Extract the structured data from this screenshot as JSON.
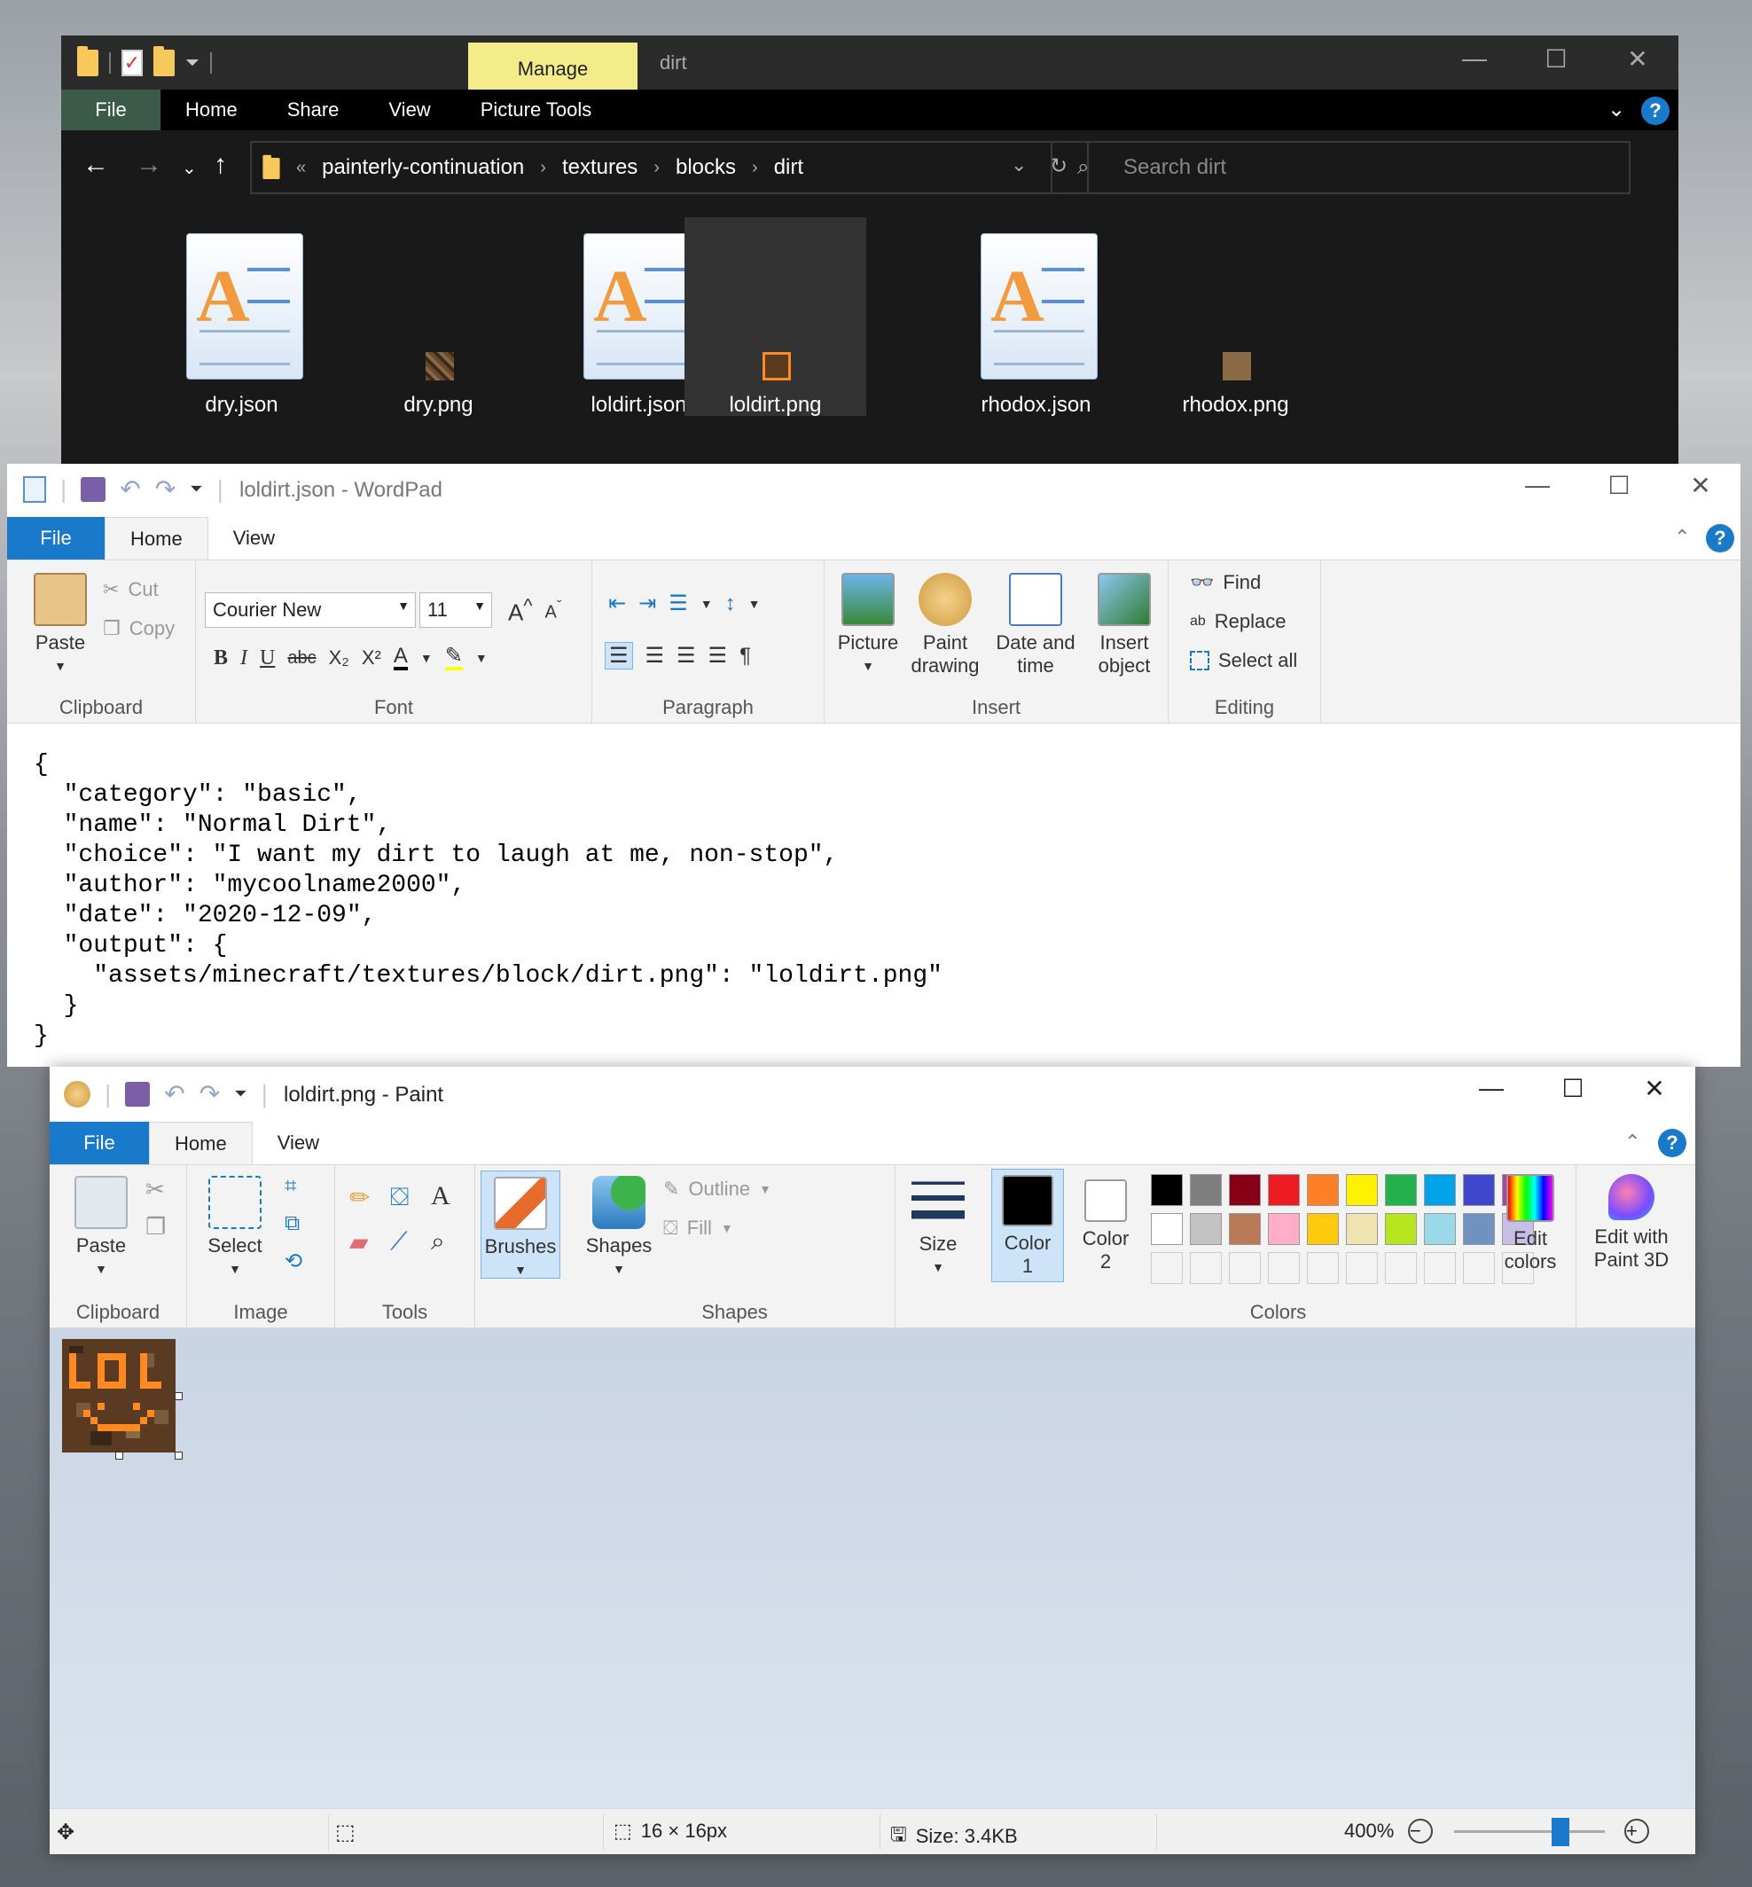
{
  "explorer": {
    "ribbon_manage": "Manage",
    "window_title": "dirt",
    "tabs": [
      "File",
      "Home",
      "Share",
      "View",
      "Picture Tools"
    ],
    "breadcrumbs": [
      "painterly-continuation",
      "textures",
      "blocks",
      "dirt"
    ],
    "search_placeholder": "Search dirt",
    "files": [
      {
        "name": "dry.json",
        "kind": "wordpad-doc"
      },
      {
        "name": "dry.png",
        "kind": "png"
      },
      {
        "name": "loldirt.json",
        "kind": "wordpad-doc"
      },
      {
        "name": "loldirt.png",
        "kind": "png",
        "selected": true
      },
      {
        "name": "rhodox.json",
        "kind": "wordpad-doc"
      },
      {
        "name": "rhodox.png",
        "kind": "png"
      }
    ]
  },
  "wordpad": {
    "title": "loldirt.json - WordPad",
    "tabs": {
      "file": "File",
      "home": "Home",
      "view": "View"
    },
    "clipboard": {
      "paste": "Paste",
      "cut": "Cut",
      "copy": "Copy",
      "group": "Clipboard"
    },
    "font": {
      "family": "Courier New",
      "size": "11",
      "group": "Font"
    },
    "paragraph": {
      "group": "Paragraph"
    },
    "insert": {
      "picture": "Picture",
      "paint_drawing_1": "Paint",
      "paint_drawing_2": "drawing",
      "date_time_1": "Date and",
      "date_time_2": "time",
      "insert_object_1": "Insert",
      "insert_object_2": "object",
      "group": "Insert"
    },
    "editing": {
      "find": "Find",
      "replace": "Replace",
      "select_all": "Select all",
      "group": "Editing"
    },
    "document_text": "{\n  \"category\": \"basic\",\n  \"name\": \"Normal Dirt\",\n  \"choice\": \"I want my dirt to laugh at me, non-stop\",\n  \"author\": \"mycoolname2000\",\n  \"date\": \"2020-12-09\",\n  \"output\": {\n    \"assets/minecraft/textures/block/dirt.png\": \"loldirt.png\"\n  }\n}"
  },
  "paint": {
    "title": "loldirt.png - Paint",
    "tabs": {
      "file": "File",
      "home": "Home",
      "view": "View"
    },
    "clipboard": {
      "paste": "Paste",
      "group": "Clipboard"
    },
    "image": {
      "select": "Select",
      "group": "Image"
    },
    "tools": {
      "group": "Tools"
    },
    "brushes": "Brushes",
    "shapes": {
      "shapes": "Shapes",
      "outline": "Outline",
      "fill": "Fill",
      "group": "Shapes"
    },
    "size": "Size",
    "colors": {
      "color1_a": "Color",
      "color1_b": "1",
      "color2_a": "Color",
      "color2_b": "2",
      "edit_colors_a": "Edit",
      "edit_colors_b": "colors",
      "group": "Colors",
      "palette_row1": [
        "#000000",
        "#7f7f7f",
        "#880015",
        "#ed1c24",
        "#ff7f27",
        "#fff200",
        "#22b14c",
        "#00a2e8",
        "#3f48cc",
        "#a349a4"
      ],
      "palette_row2": [
        "#ffffff",
        "#c3c3c3",
        "#b97a57",
        "#ffaec9",
        "#ffc90e",
        "#efe4b0",
        "#b5e61d",
        "#99d9ea",
        "#7092be",
        "#c8bfe7"
      ]
    },
    "paint3d_a": "Edit with",
    "paint3d_b": "Paint 3D",
    "status": {
      "dimensions": "16 × 16px",
      "size": "Size: 3.4KB",
      "zoom": "400%"
    }
  }
}
